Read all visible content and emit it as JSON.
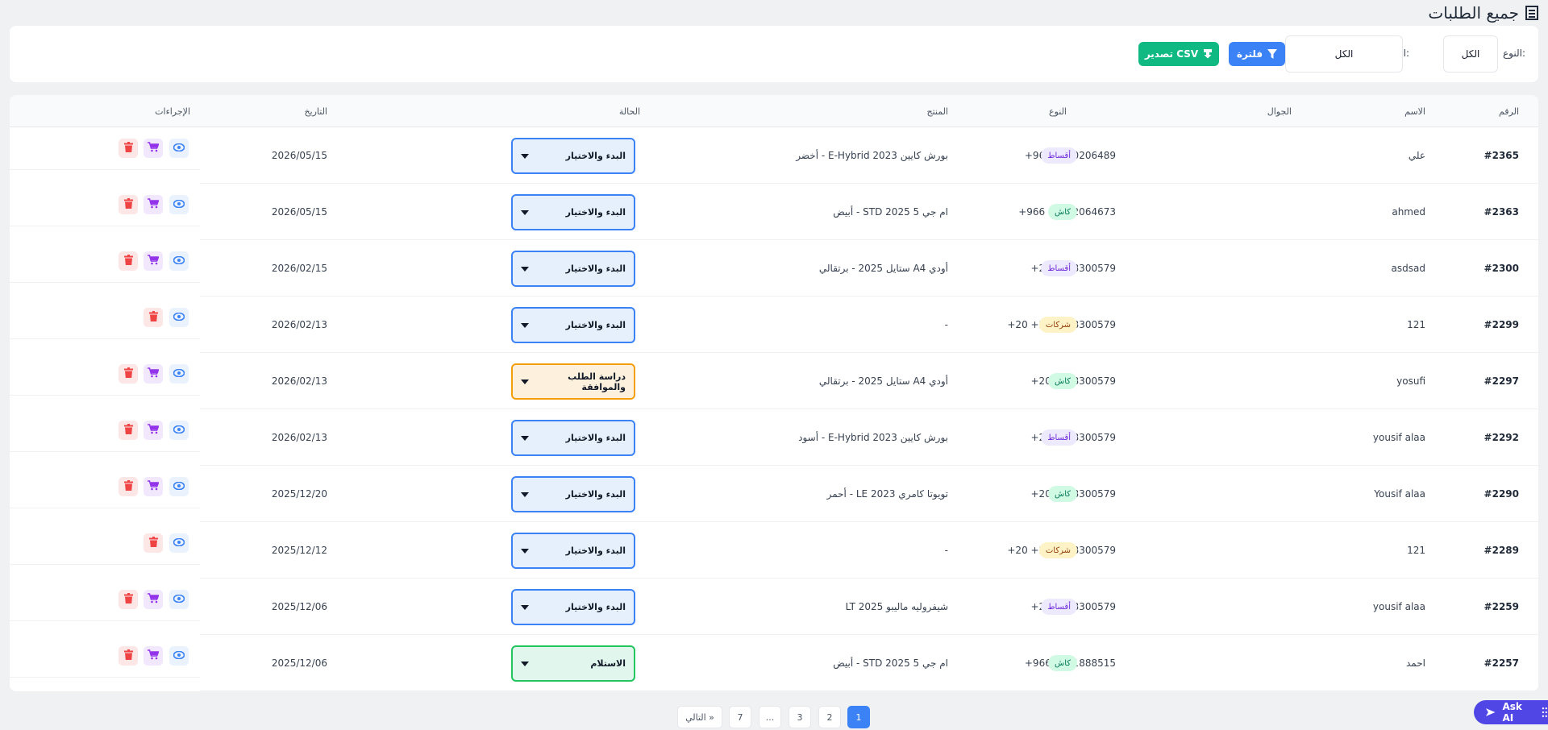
{
  "page": {
    "title": "جميع الطلبات"
  },
  "filters": {
    "type_label": "النوع:",
    "type_value": "الكل",
    "status_label": "الحالة:",
    "status_value": "الكل",
    "filter_button": "فلترة",
    "export_button": "تصدير CSV"
  },
  "table": {
    "headers": {
      "number": "الرقم",
      "name": "الاسم",
      "phone": "الجوال",
      "type": "النوع",
      "product": "المنتج",
      "status": "الحالة",
      "date": "التاريخ",
      "actions": "الإجراءات"
    },
    "rows": [
      {
        "number": "#2365",
        "name": "علي",
        "phone": "+966 0100206489",
        "type": "أقساط",
        "type_kind": "aqsat",
        "product": "بورش كايين E-Hybrid 2023 - أخضر",
        "status": "البدء والاختيار",
        "status_kind": "blue",
        "date": "2026/05/15",
        "has_cart": true
      },
      {
        "number": "#2363",
        "name": "ahmed",
        "phone": "+966 01002064673",
        "type": "كاش",
        "type_kind": "cash",
        "product": "ام جي 5 STD 2025 - أبيض",
        "status": "البدء والاختيار",
        "status_kind": "blue",
        "date": "2026/05/15",
        "has_cart": true
      },
      {
        "number": "#2300",
        "name": "asdsad",
        "phone": "+20 1018300579",
        "type": "أقساط",
        "type_kind": "aqsat",
        "product": "أودي A4 ستايل 2025 - برتقالي",
        "status": "البدء والاختيار",
        "status_kind": "blue",
        "date": "2026/02/15",
        "has_cart": true
      },
      {
        "number": "#2299",
        "name": "121",
        "phone": "+20 +20 1018300579",
        "type": "شركات",
        "type_kind": "comp",
        "product": "-",
        "status": "البدء والاختيار",
        "status_kind": "blue",
        "date": "2026/02/13",
        "has_cart": false
      },
      {
        "number": "#2297",
        "name": "yosufi",
        "phone": "+20 1018300579",
        "type": "كاش",
        "type_kind": "cash",
        "product": "أودي A4 ستايل 2025 - برتقالي",
        "status": "دراسة الطلب والموافقة",
        "status_kind": "orange",
        "date": "2026/02/13",
        "has_cart": true
      },
      {
        "number": "#2292",
        "name": "yousif alaa",
        "phone": "+20 1018300579",
        "type": "أقساط",
        "type_kind": "aqsat",
        "product": "بورش كايين E-Hybrid 2023 - أسود",
        "status": "البدء والاختيار",
        "status_kind": "blue",
        "date": "2026/02/13",
        "has_cart": true
      },
      {
        "number": "#2290",
        "name": "Yousif alaa",
        "phone": "+20 1018300579",
        "type": "كاش",
        "type_kind": "cash",
        "product": "تويوتا كامري LE 2023 - أحمر",
        "status": "البدء والاختيار",
        "status_kind": "blue",
        "date": "2025/12/20",
        "has_cart": true
      },
      {
        "number": "#2289",
        "name": "121",
        "phone": "+20 +20 1018300579",
        "type": "شركات",
        "type_kind": "comp",
        "product": "-",
        "status": "البدء والاختيار",
        "status_kind": "blue",
        "date": "2025/12/12",
        "has_cart": false
      },
      {
        "number": "#2259",
        "name": "yousif alaa",
        "phone": "+20 1018300579",
        "type": "أقساط",
        "type_kind": "aqsat",
        "product": "شيفروليه ماليبو LT 2025",
        "status": "البدء والاختيار",
        "status_kind": "blue",
        "date": "2025/12/06",
        "has_cart": true
      },
      {
        "number": "#2257",
        "name": "احمد",
        "phone": "+966 0551888515",
        "type": "كاش",
        "type_kind": "cash",
        "product": "ام جي 5 STD 2025 - أبيض",
        "status": "الاستلام",
        "status_kind": "green",
        "date": "2025/12/06",
        "has_cart": true
      }
    ]
  },
  "pagination": {
    "pages": [
      "1",
      "2",
      "3",
      "...",
      "7"
    ],
    "active": "1",
    "next": "التالي »"
  },
  "assistant": {
    "label": "Ask AI"
  },
  "colors": {
    "primary": "#3b82f6",
    "success": "#10b981",
    "danger": "#ef4444",
    "purple": "#9333ea",
    "warning": "#f59e0b"
  }
}
